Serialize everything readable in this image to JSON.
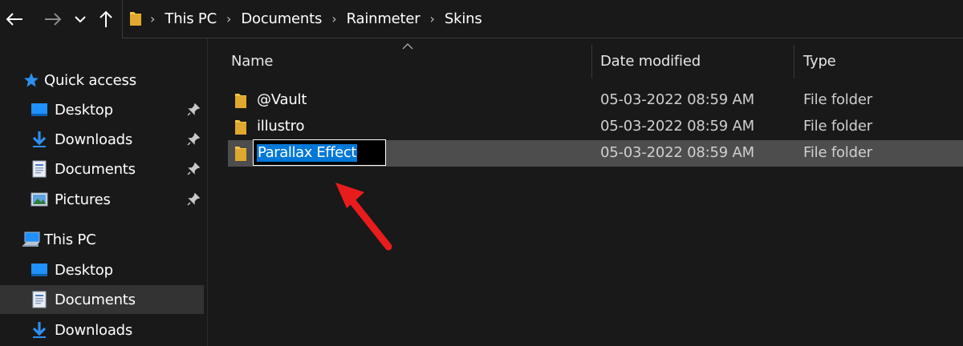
{
  "breadcrumbs": [
    "This PC",
    "Documents",
    "Rainmeter",
    "Skins"
  ],
  "sidebar": {
    "quick_access_label": "Quick access",
    "quick_items": [
      {
        "label": "Desktop",
        "icon": "desktop-icon",
        "pinned": true
      },
      {
        "label": "Downloads",
        "icon": "downloads-icon",
        "pinned": true
      },
      {
        "label": "Documents",
        "icon": "documents-icon",
        "pinned": true
      },
      {
        "label": "Pictures",
        "icon": "pictures-icon",
        "pinned": true
      }
    ],
    "this_pc_label": "This PC",
    "pc_items": [
      {
        "label": "Desktop",
        "icon": "desktop-icon"
      },
      {
        "label": "Documents",
        "icon": "documents-icon",
        "selected": true
      },
      {
        "label": "Downloads",
        "icon": "downloads-icon"
      }
    ]
  },
  "columns": {
    "name": "Name",
    "date": "Date modified",
    "type": "Type"
  },
  "files": [
    {
      "name": "@Vault",
      "date": "05-03-2022 08:59 AM",
      "type": "File folder"
    },
    {
      "name": "illustro",
      "date": "05-03-2022 08:59 AM",
      "type": "File folder"
    },
    {
      "name": "Parallax Effect",
      "date": "05-03-2022 08:59 AM",
      "type": "File folder",
      "renaming": true
    }
  ],
  "colors": {
    "background": "#191919",
    "selection": "#0078d7",
    "folder": "#f5c542",
    "annotation_arrow": "#e81c1c"
  }
}
